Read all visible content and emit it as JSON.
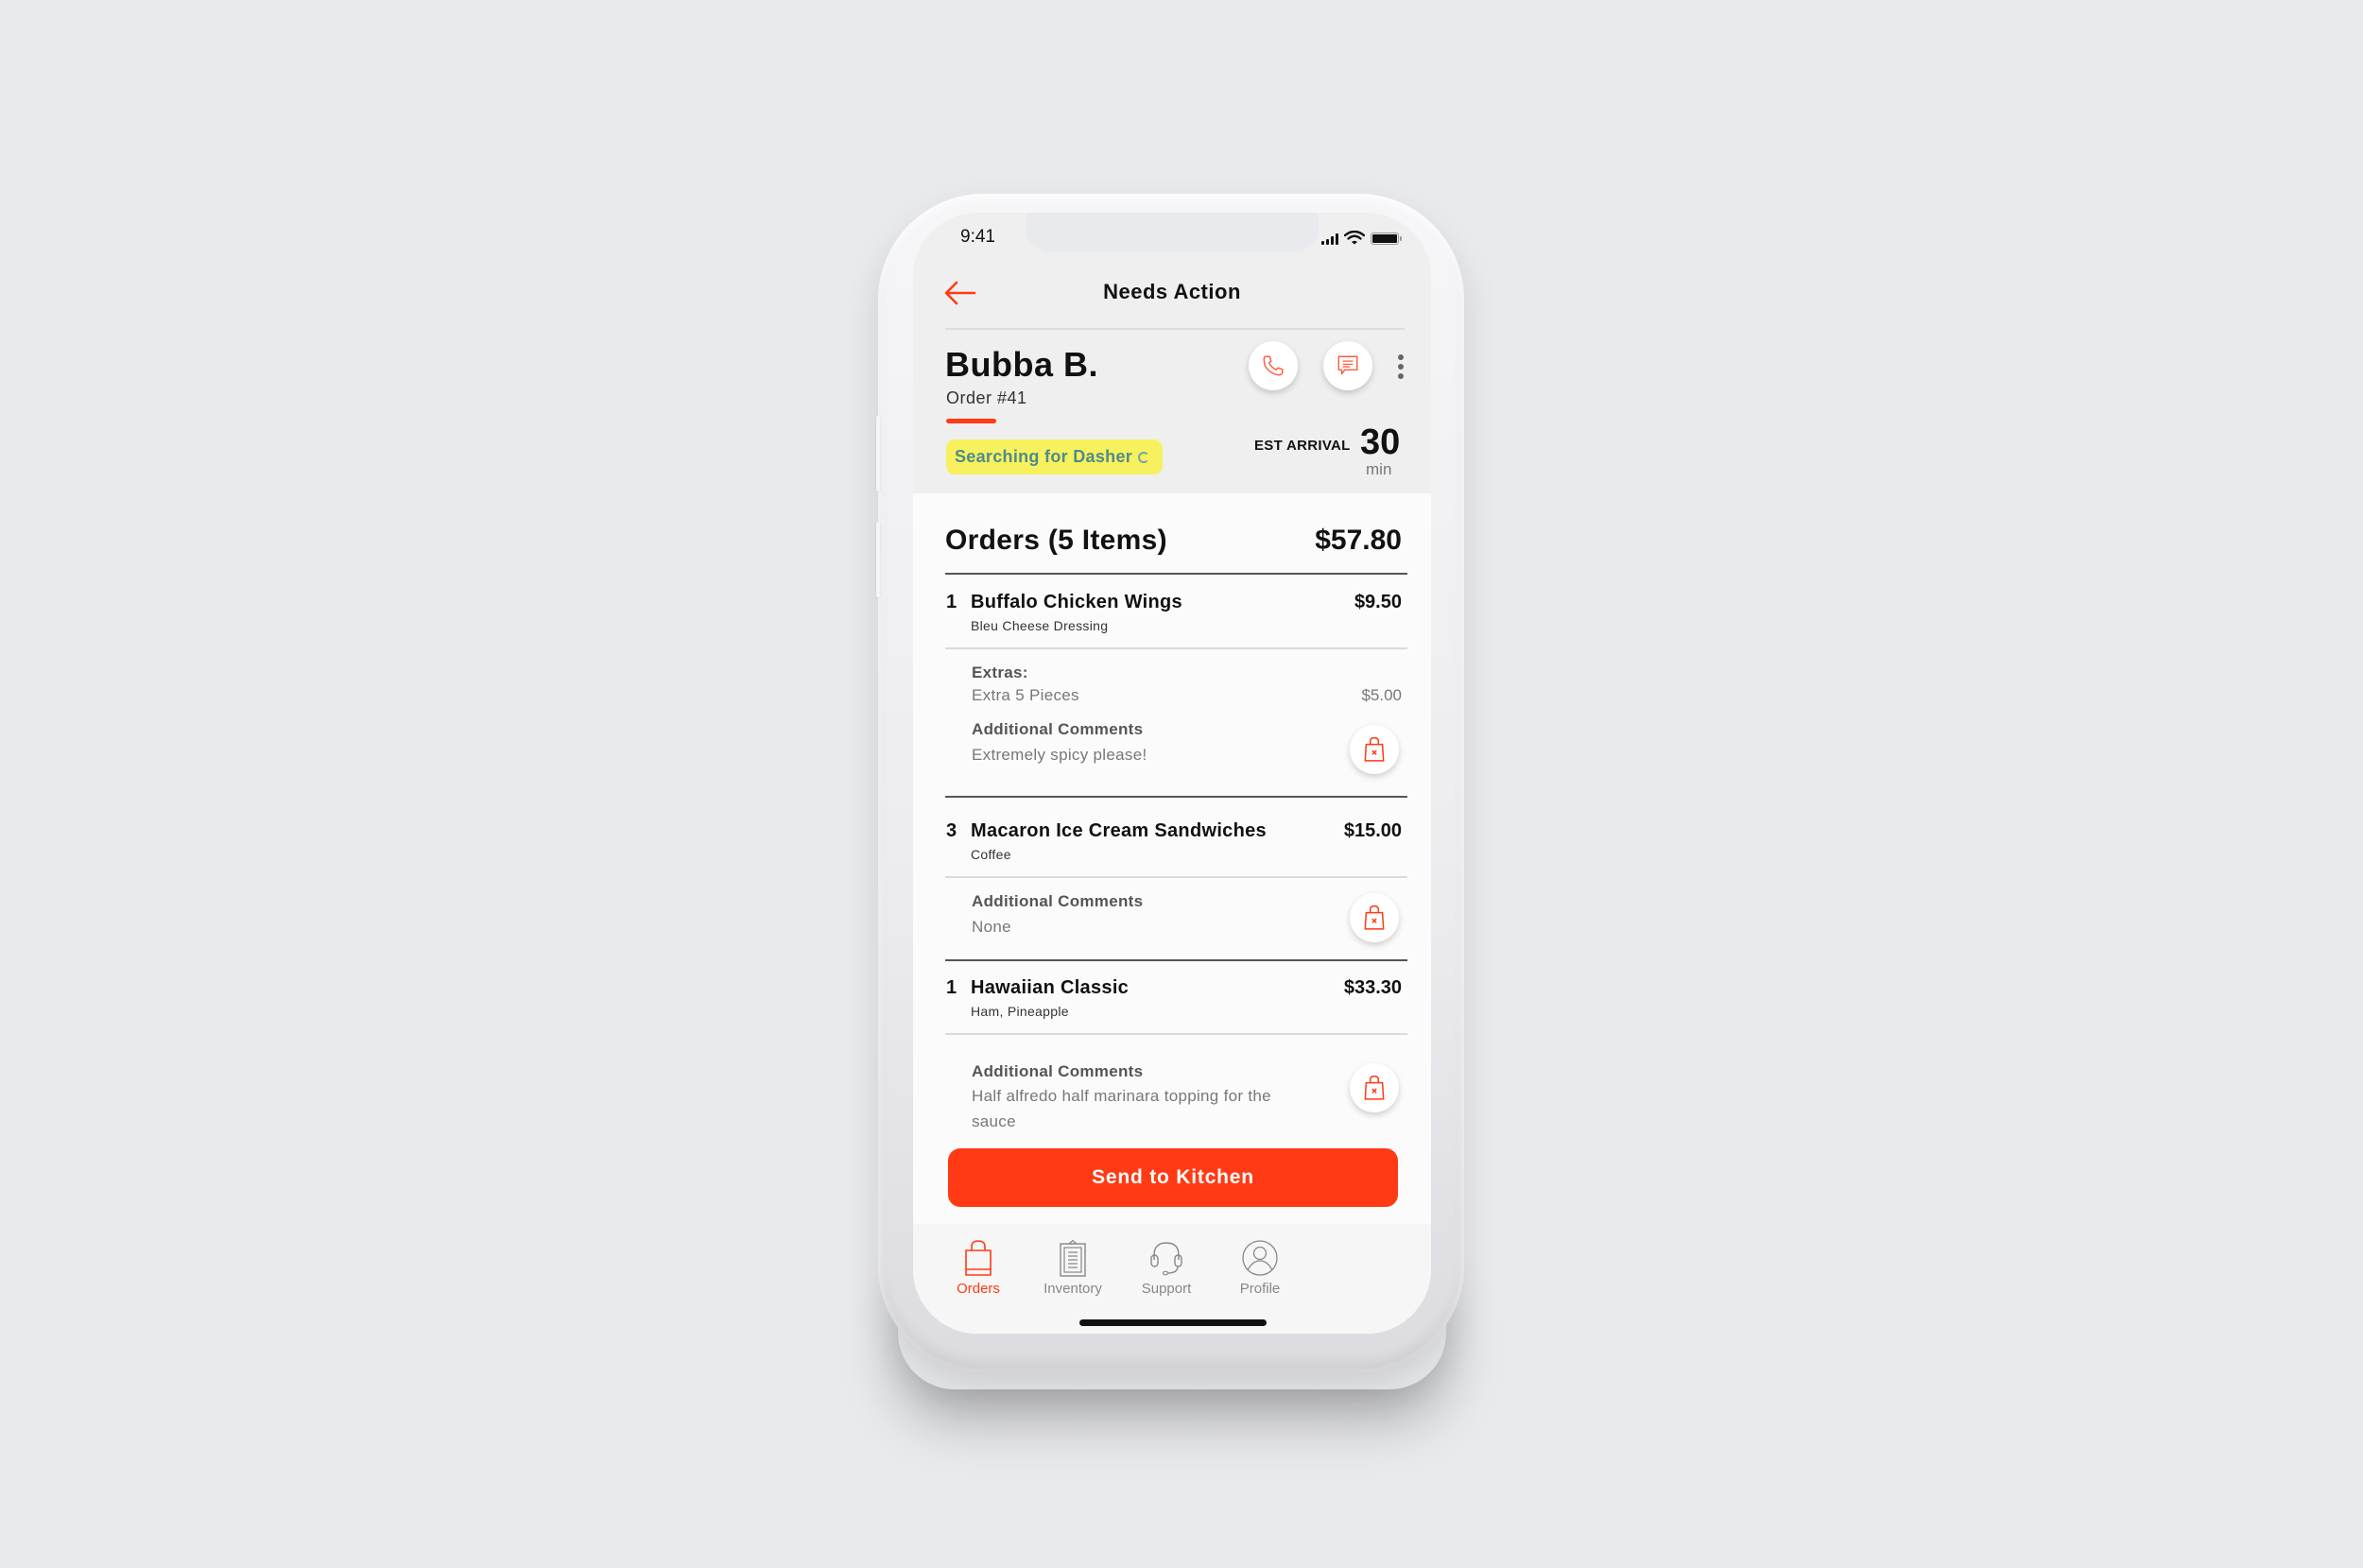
{
  "status_bar": {
    "time": "9:41"
  },
  "nav": {
    "title": "Needs Action",
    "back_icon": "arrow-left-icon"
  },
  "customer": {
    "name": "Bubba B.",
    "order_number": "Order #41",
    "status": "Searching for Dasher",
    "actions": [
      {
        "name": "call",
        "icon": "phone-icon"
      },
      {
        "name": "message",
        "icon": "chat-icon"
      },
      {
        "name": "more",
        "icon": "kebab-menu-icon"
      }
    ],
    "eta": {
      "label": "EST ARRIVAL",
      "value": "30",
      "unit": "min"
    }
  },
  "orders": {
    "title": "Orders (5 Items)",
    "total": "$57.80",
    "items": [
      {
        "qty": "1",
        "name": "Buffalo Chicken Wings",
        "price": "$9.50",
        "option": "Bleu Cheese Dressing",
        "extras_label": "Extras:",
        "extras": [
          {
            "name": "Extra 5 Pieces",
            "price": "$5.00"
          }
        ],
        "comments_label": "Additional Comments",
        "comments": "Extremely spicy please!"
      },
      {
        "qty": "3",
        "name": "Macaron Ice Cream Sandwiches",
        "price": "$15.00",
        "option": "Coffee",
        "comments_label": "Additional Comments",
        "comments": "None"
      },
      {
        "qty": "1",
        "name": "Hawaiian Classic",
        "price": "$33.30",
        "option": "Ham, Pineapple",
        "comments_label": "Additional Comments",
        "comments": "Half alfredo half marinara topping for the sauce"
      }
    ]
  },
  "primary_action": {
    "label": "Send to Kitchen"
  },
  "tabbar": {
    "active": "Orders",
    "tabs": [
      {
        "label": "Orders",
        "icon": "shopping-bag-icon"
      },
      {
        "label": "Inventory",
        "icon": "clipboard-icon"
      },
      {
        "label": "Support",
        "icon": "headset-icon"
      },
      {
        "label": "Profile",
        "icon": "user-circle-icon"
      }
    ]
  },
  "colors": {
    "accent": "#ff3a14",
    "status_pill_bg": "#f7f15f",
    "status_pill_text": "#4e8b8a",
    "header_bg": "#efefef",
    "body_bg": "#fbfbfb",
    "page_bg": "#e9eaed"
  }
}
